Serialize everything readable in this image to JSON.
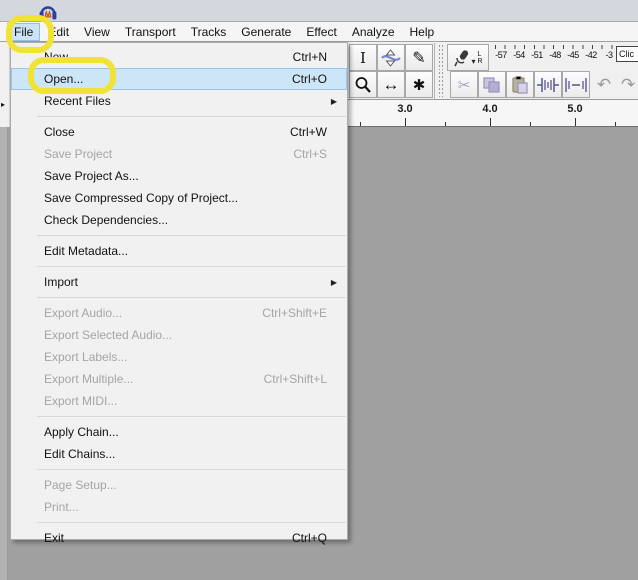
{
  "menubar": {
    "items": [
      "File",
      "Edit",
      "View",
      "Transport",
      "Tracks",
      "Generate",
      "Effect",
      "Analyze",
      "Help"
    ],
    "active_item": "File"
  },
  "file_menu": {
    "items": [
      {
        "label": "New",
        "shortcut": "Ctrl+N",
        "enabled": true
      },
      {
        "label": "Open...",
        "shortcut": "Ctrl+O",
        "enabled": true,
        "highlighted": true
      },
      {
        "label": "Recent Files",
        "submenu": true,
        "enabled": true
      },
      {
        "separator": true
      },
      {
        "label": "Close",
        "shortcut": "Ctrl+W",
        "enabled": true
      },
      {
        "label": "Save Project",
        "shortcut": "Ctrl+S",
        "enabled": false
      },
      {
        "label": "Save Project As...",
        "enabled": true
      },
      {
        "label": "Save Compressed Copy of Project...",
        "enabled": true
      },
      {
        "label": "Check Dependencies...",
        "enabled": true
      },
      {
        "separator": true
      },
      {
        "label": "Edit Metadata...",
        "enabled": true
      },
      {
        "separator": true
      },
      {
        "label": "Import",
        "submenu": true,
        "enabled": true
      },
      {
        "separator": true
      },
      {
        "label": "Export Audio...",
        "shortcut": "Ctrl+Shift+E",
        "enabled": false
      },
      {
        "label": "Export Selected Audio...",
        "enabled": false
      },
      {
        "label": "Export Labels...",
        "enabled": false
      },
      {
        "label": "Export Multiple...",
        "shortcut": "Ctrl+Shift+L",
        "enabled": false
      },
      {
        "label": "Export MIDI...",
        "enabled": false
      },
      {
        "separator": true
      },
      {
        "label": "Apply Chain...",
        "enabled": true
      },
      {
        "label": "Edit Chains...",
        "enabled": true
      },
      {
        "separator": true
      },
      {
        "label": "Page Setup...",
        "enabled": false
      },
      {
        "label": "Print...",
        "enabled": false
      },
      {
        "separator": true
      },
      {
        "label": "Exit",
        "shortcut": "Ctrl+Q",
        "enabled": true
      }
    ]
  },
  "toolbar": {
    "tools_row1": [
      "selection-tool",
      "envelope-tool",
      "draw-tool"
    ],
    "tools_row2": [
      "zoom-tool",
      "time-shift-tool",
      "multi-tool"
    ],
    "edit_buttons": [
      "cut",
      "copy",
      "paste",
      "trim-audio",
      "silence-audio"
    ],
    "history_buttons": [
      "undo",
      "redo"
    ]
  },
  "icons": {
    "selection": "I",
    "draw": "✎",
    "time_shift": "↔",
    "multi": "✱",
    "cut": "✂",
    "undo": "↶",
    "redo": "↷",
    "submenu_arrow": "▶",
    "mic_dropdown": "▾",
    "left_edge_arrow": "▸"
  },
  "record_meter": {
    "scale_labels": [
      "-57",
      "-54",
      "-51",
      "-48",
      "-45",
      "-42",
      "-3"
    ],
    "channel_labels": [
      "L",
      "R"
    ],
    "tooltip_text": "Clic"
  },
  "timeline": {
    "labels": [
      "3.0",
      "4.0",
      "5.0"
    ]
  },
  "annotations": {
    "highlight_color": "#f0e335",
    "targets": [
      "file-menu-button",
      "open-menu-item"
    ]
  },
  "colors": {
    "workspace": "#a0a0a0",
    "titlebar": "#d4d7de",
    "menu_highlight": "#cde6f7",
    "menubar_active": "#cbe3f7"
  }
}
